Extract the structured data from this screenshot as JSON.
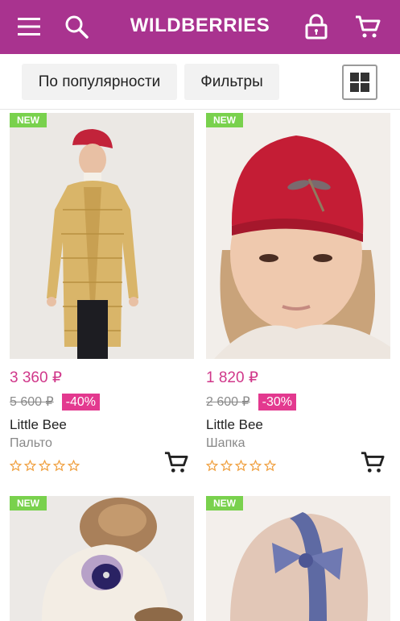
{
  "header": {
    "logo": "WILDBERRIES",
    "icons": [
      "menu-icon",
      "search-icon",
      "lock-icon",
      "cart-icon"
    ],
    "brand_color": "#a9338f"
  },
  "toolbar": {
    "sort_label": "По популярности",
    "filters_label": "Фильтры",
    "view_toggle_icon": "grid-view-icon"
  },
  "products": [
    {
      "badge": "NEW",
      "price": "3 360 ₽",
      "old_price": "5 600 ₽",
      "discount": "-40%",
      "brand": "Little Bee",
      "type": "Пальто",
      "rating": 0
    },
    {
      "badge": "NEW",
      "price": "1 820 ₽",
      "old_price": "2 600 ₽",
      "discount": "-30%",
      "brand": "Little Bee",
      "type": "Шапка",
      "rating": 0
    },
    {
      "badge": "NEW"
    },
    {
      "badge": "NEW"
    }
  ],
  "colors": {
    "price": "#d0378a",
    "discount_bg": "#e3398f",
    "new_badge": "#79d14d",
    "star_outline": "#f0a040"
  }
}
